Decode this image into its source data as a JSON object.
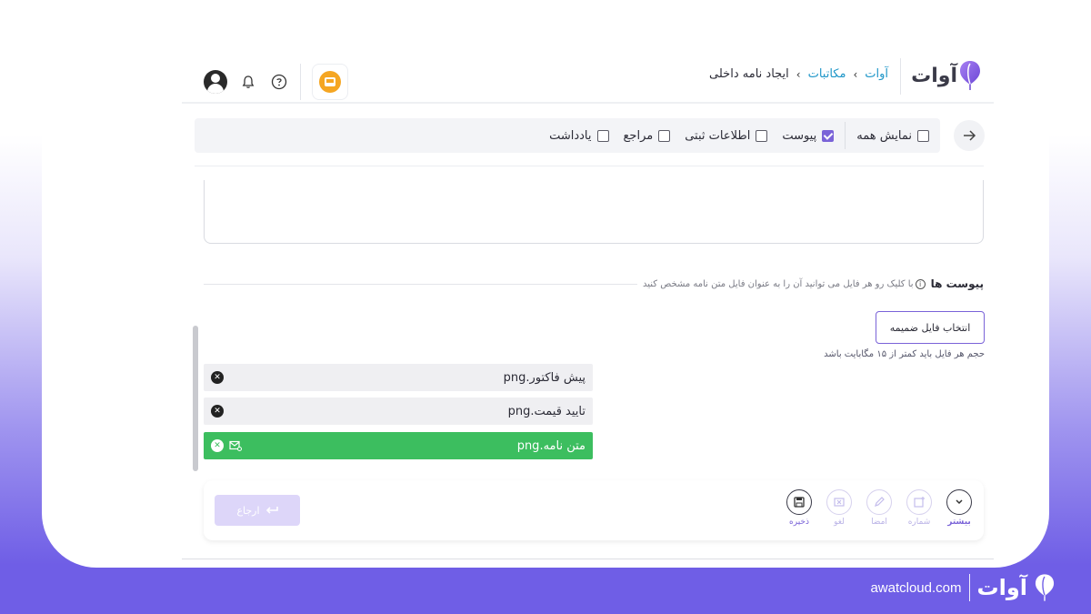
{
  "header": {
    "logo_text": "آوات",
    "breadcrumb": [
      "آوات",
      "مکاتبات",
      "ایجاد نامه داخلی"
    ]
  },
  "filters": {
    "items": [
      {
        "label": "نمایش همه",
        "checked": false
      },
      {
        "label": "پیوست",
        "checked": true
      },
      {
        "label": "اطلاعات ثبتی",
        "checked": false
      },
      {
        "label": "مراجع",
        "checked": false
      },
      {
        "label": "یادداشت",
        "checked": false
      }
    ]
  },
  "attachments": {
    "title": "پیوست ها",
    "hint": "با کلیک رو هر فایل می توانید آن را به عنوان فایل متن نامه مشخص کنید",
    "select_button": "انتخاب فایل ضمیمه",
    "size_hint": "حجم هر فایل باید کمتر از ۱۵ مگابایت باشد",
    "files": [
      {
        "name": "پیش فاکتور.png",
        "main": false
      },
      {
        "name": "تایید قیمت.png",
        "main": false
      },
      {
        "name": "متن نامه.png",
        "main": true
      }
    ]
  },
  "actions": {
    "items": [
      {
        "label": "بیشتر",
        "icon": "chevron-down-icon",
        "active": true
      },
      {
        "label": "شماره",
        "icon": "number-icon",
        "active": false
      },
      {
        "label": "امضا",
        "icon": "pen-icon",
        "active": false
      },
      {
        "label": "لغو",
        "icon": "cancel-icon",
        "active": false
      },
      {
        "label": "ذخیره",
        "icon": "save-icon",
        "active": false,
        "dark": true
      }
    ],
    "return_label": "ارجاع"
  },
  "footer": {
    "logo_text": "آوات",
    "domain": "awatcloud.com"
  },
  "colors": {
    "accent": "#7a63d8",
    "link": "#1e96c8",
    "main_file": "#3cbe5f"
  }
}
